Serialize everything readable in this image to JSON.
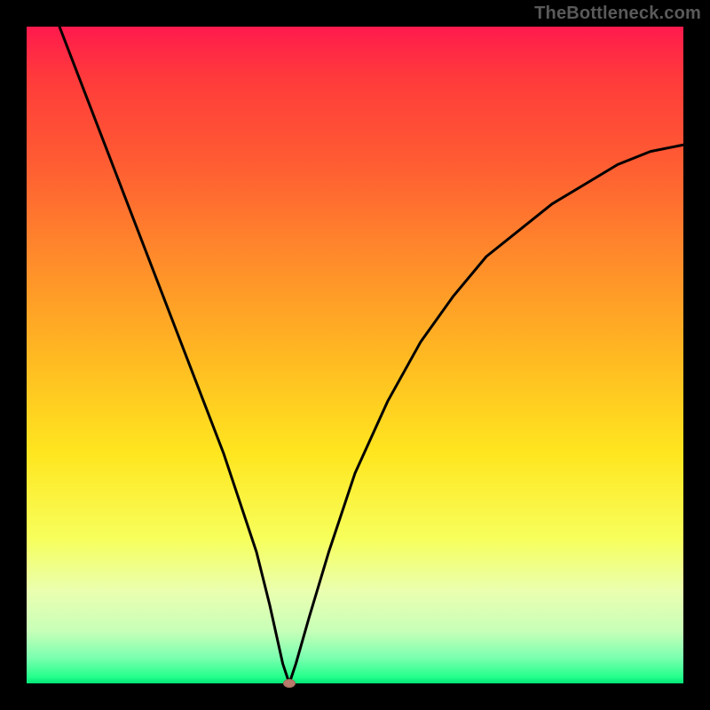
{
  "watermark": "TheBottleneck.com",
  "chart_data": {
    "type": "line",
    "title": "",
    "xlabel": "",
    "ylabel": "",
    "xlim": [
      0,
      100
    ],
    "ylim": [
      0,
      100
    ],
    "grid": false,
    "series": [
      {
        "name": "bottleneck-curve",
        "x": [
          5,
          10,
          15,
          20,
          25,
          30,
          35,
          37,
          39,
          40,
          41,
          43,
          46,
          50,
          55,
          60,
          65,
          70,
          75,
          80,
          85,
          90,
          95,
          100
        ],
        "values": [
          100,
          87,
          74,
          61,
          48,
          35,
          20,
          12,
          3,
          0,
          3,
          10,
          20,
          32,
          43,
          52,
          59,
          65,
          69,
          73,
          76,
          79,
          81,
          82
        ]
      }
    ],
    "marker": {
      "x": 40,
      "y": 0
    },
    "background_gradient": {
      "top": "#ff1a4d",
      "mid": "#ffe61f",
      "bottom": "#00e676"
    }
  }
}
